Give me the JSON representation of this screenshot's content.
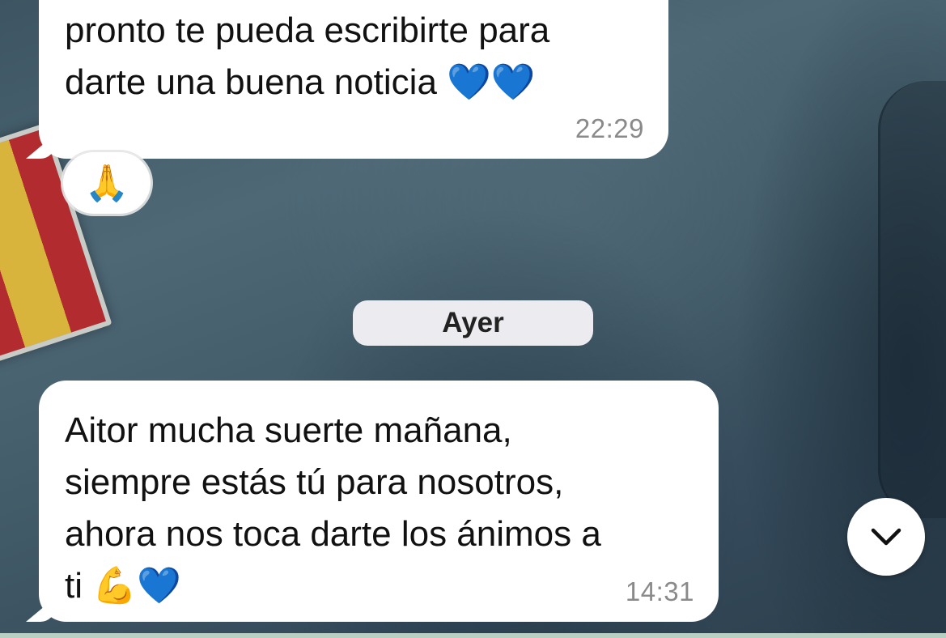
{
  "messages": [
    {
      "line1": "pronto te pueda escribirte para",
      "line2": "darte una buena noticia ",
      "emoji": "💙💙",
      "time": "22:29",
      "reaction": "🙏"
    },
    {
      "line1": "Aitor mucha suerte mañana,",
      "line2": "siempre estás tú para nosotros,",
      "line3": "ahora nos toca darte los ánimos a",
      "line4": "ti ",
      "emoji_muscle": "💪",
      "emoji_heart": "💙",
      "time": "14:31"
    }
  ],
  "date_separator": "Ayer",
  "scroll_button": {
    "icon": "chevron-down-icon"
  },
  "colors": {
    "bubble": "#ffffff",
    "heart": "#1673f2",
    "timestamp": "#8a8a8a",
    "date_pill": "#ececf0"
  }
}
